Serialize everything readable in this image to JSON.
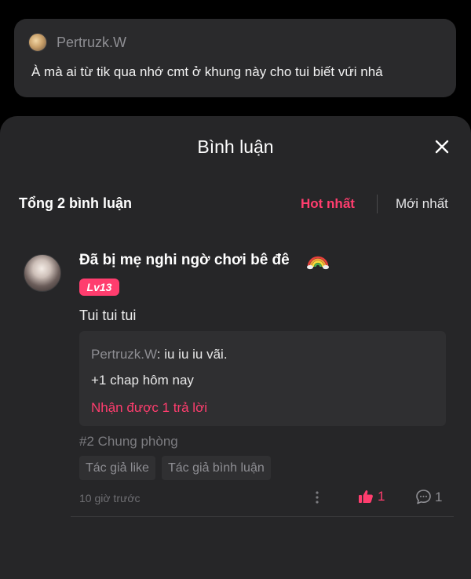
{
  "top_comment": {
    "author": "Pertruzk.W",
    "text": "À mà ai từ tik qua nhớ cmt ở khung này cho tui biết vứi nhá"
  },
  "sheet": {
    "title": "Bình luận",
    "close_icon": "close-icon",
    "total_label": "Tổng 2 bình luận",
    "sort": {
      "hot": "Hot nhất",
      "newest": "Mới nhất",
      "active": "hot"
    }
  },
  "comment": {
    "name": "Đã bị mẹ nghi ngờ chơi bê đê",
    "name_emoji": "rainbow-emoji",
    "level": "Lv13",
    "body": "Tui tui tui",
    "reply_preview": {
      "author": "Pertruzk.W",
      "separator": ":",
      "text": " iu iu iu vãi.",
      "line2": "+1 chap hôm nay",
      "more": "Nhận được 1 trả lời"
    },
    "tag_line": "#2 Chung phòng",
    "chips": [
      "Tác giả like",
      "Tác giả bình luận"
    ],
    "time": "10 giờ trước",
    "likes": "1",
    "replies": "1"
  },
  "colors": {
    "accent": "#ff3d6e",
    "sheet_bg": "#262628",
    "card_bg": "#2a2a2c",
    "reply_bg": "#2f2f31",
    "muted": "#8e8e93"
  }
}
